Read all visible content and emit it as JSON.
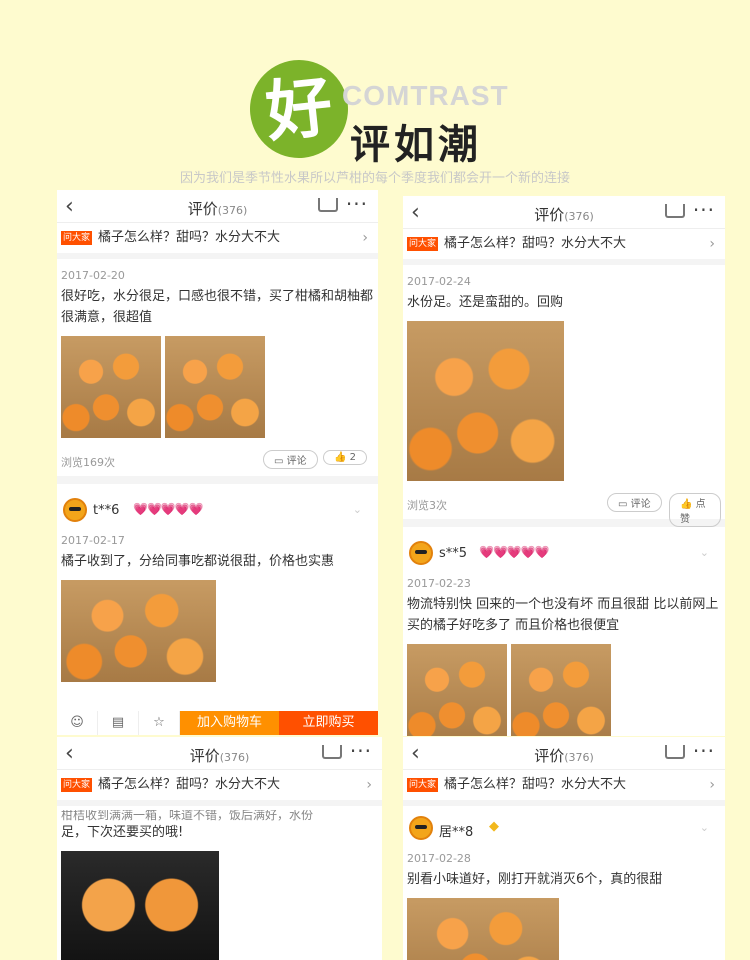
{
  "header": {
    "badge_char": "好",
    "brand": "COMTRAST",
    "title": "评如潮",
    "tagline": "因为我们是季节性水果所以芦柑的每个季度我们都会开一个新的连接"
  },
  "nav": {
    "title": "评价",
    "count": "(376)"
  },
  "ask": {
    "tag": "问大家",
    "question": "橘子怎么样？甜吗？水分大不大"
  },
  "cards": {
    "c1": {
      "post1": {
        "date": "2017-02-20",
        "text": "很好吃，水分很足，口感也很不错，买了柑橘和胡柚都很满意，很超值",
        "views": "浏览169次",
        "comment_label": "评论",
        "like_count": "2"
      },
      "post2": {
        "user": "t**6",
        "hearts": "💗💗💗💗💗",
        "date": "2017-02-17",
        "text": "橘子收到了，分给同事吃都说很甜，价格也实惠"
      },
      "bottom_bar": {
        "add_cart": "加入购物车",
        "buy_now": "立即购买"
      }
    },
    "c2": {
      "post1": {
        "date": "2017-02-24",
        "text": "水份足。还是蛮甜的。回购",
        "views": "浏览3次",
        "comment_label": "评论",
        "like_label": "点赞"
      },
      "post2": {
        "user": "s**5",
        "hearts": "💗💗💗💗💗",
        "date": "2017-02-23",
        "text": "物流特别快 回来的一个也没有坏 而且很甜 比以前网上买的橘子好吃多了 而且价格也很便宜"
      }
    },
    "c3": {
      "post1": {
        "text_top": "柑桔收到满满一箱，味道不错，饭后满好，水份",
        "text": "足，下次还要买的哦!"
      }
    },
    "c4": {
      "post1": {
        "user": "居**8",
        "diamond": "◆",
        "date": "2017-02-28",
        "text": "别看小味道好，刚打开就消灭6个，真的很甜"
      }
    }
  },
  "icons": [
    "back-arrow-icon",
    "cart-icon",
    "more-icon",
    "comment-icon",
    "thumbs-up-icon",
    "smiley-icon",
    "store-icon",
    "star-icon"
  ]
}
